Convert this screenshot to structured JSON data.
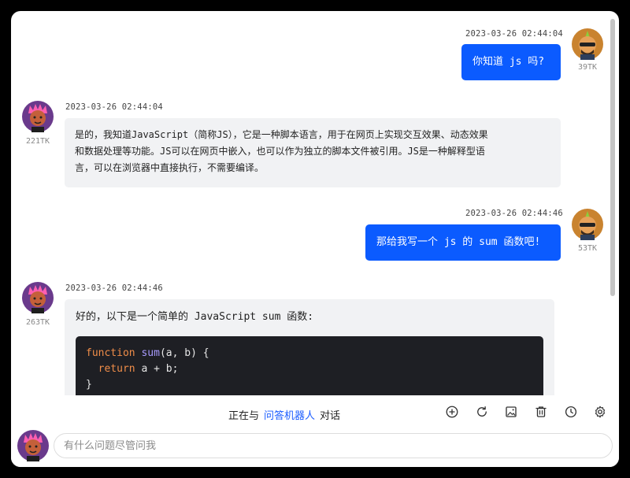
{
  "messages": [
    {
      "role": "user",
      "timestamp": "2023-03-26 02:44:04",
      "text": "你知道 js 吗?",
      "tokens": "39TK"
    },
    {
      "role": "assistant",
      "timestamp": "2023-03-26 02:44:04",
      "lines": [
        "是的，我知道JavaScript（简称JS），它是一种脚本语言，用于在网页上实现交互效果、动态效果",
        "和数据处理等功能。JS可以在网页中嵌入，也可以作为独立的脚本文件被引用。JS是一种解释型语",
        "言，可以在浏览器中直接执行，不需要编译。"
      ],
      "tokens": "221TK"
    },
    {
      "role": "user",
      "timestamp": "2023-03-26 02:44:46",
      "text": "那给我写一个 js 的 sum 函数吧!",
      "tokens": "53TK"
    },
    {
      "role": "assistant",
      "timestamp": "2023-03-26 02:44:46",
      "text": "好的，以下是一个简单的 JavaScript sum 函数:",
      "tokens": "263TK",
      "code": {
        "kw_function": "function",
        "fn_name": "sum",
        "params": "(a, b) {",
        "kw_return": "return",
        "return_expr": " a + b;",
        "close": "}"
      }
    }
  ],
  "status": {
    "prefix": "正在与",
    "bot_name": "问答机器人",
    "suffix": "对话"
  },
  "toolbar": [
    "add-icon",
    "refresh-icon",
    "image-icon",
    "trash-icon",
    "history-icon",
    "gear-icon"
  ],
  "input": {
    "placeholder": "有什么问题尽管问我",
    "value": ""
  },
  "colors": {
    "user_bubble": "#0b5bff",
    "bot_bubble": "#f1f2f4",
    "bot_name": "#1a5cff",
    "code_bg": "#1e1f24"
  }
}
